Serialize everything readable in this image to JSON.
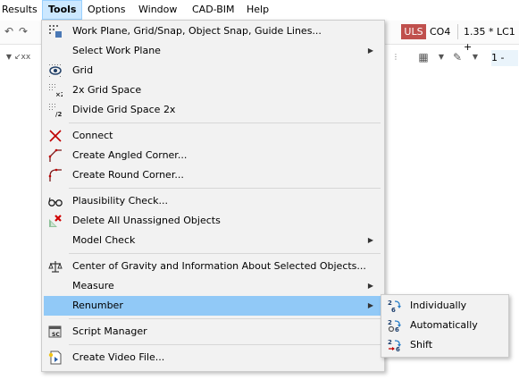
{
  "menubar": {
    "items": [
      "Results",
      "Tools",
      "Options",
      "Window",
      "CAD-BIM",
      "Help"
    ],
    "active": "Tools"
  },
  "toolbar": {
    "load_type": "ULS",
    "combo": "CO4",
    "combo_expression": "1.35 * LC1 +",
    "right_value": "1 -"
  },
  "tools_menu": {
    "items": [
      {
        "label": "Work Plane, Grid/Snap, Object Snap, Guide Lines...",
        "icon": "grid-settings-icon"
      },
      {
        "label": "Select Work Plane",
        "icon": "",
        "submenu": true
      },
      {
        "label": "Grid",
        "icon": "grid-eye-icon"
      },
      {
        "label": "2x Grid Space",
        "icon": "grid-double-icon"
      },
      {
        "label": "Divide Grid Space 2x",
        "icon": "grid-divide-icon"
      },
      {
        "label": "Connect",
        "icon": "connect-icon"
      },
      {
        "label": "Create Angled Corner...",
        "icon": "angled-corner-icon"
      },
      {
        "label": "Create Round Corner...",
        "icon": "round-corner-icon"
      },
      {
        "label": "Plausibility Check...",
        "icon": "glasses-icon"
      },
      {
        "label": "Delete All Unassigned Objects",
        "icon": "delete-objects-icon"
      },
      {
        "label": "Model Check",
        "icon": "",
        "submenu": true
      },
      {
        "label": "Center of Gravity and Information About Selected Objects...",
        "icon": "balance-icon"
      },
      {
        "label": "Measure",
        "icon": "",
        "submenu": true
      },
      {
        "label": "Renumber",
        "icon": "",
        "submenu": true,
        "highlighted": true
      },
      {
        "label": "Script Manager",
        "icon": "script-icon"
      },
      {
        "label": "Create Video File...",
        "icon": "video-file-icon"
      }
    ]
  },
  "renumber_submenu": {
    "items": [
      {
        "label": "Individually",
        "icon": "renumber-individually-icon"
      },
      {
        "label": "Automatically",
        "icon": "renumber-automatically-icon"
      },
      {
        "label": "Shift",
        "icon": "renumber-shift-icon"
      }
    ]
  }
}
